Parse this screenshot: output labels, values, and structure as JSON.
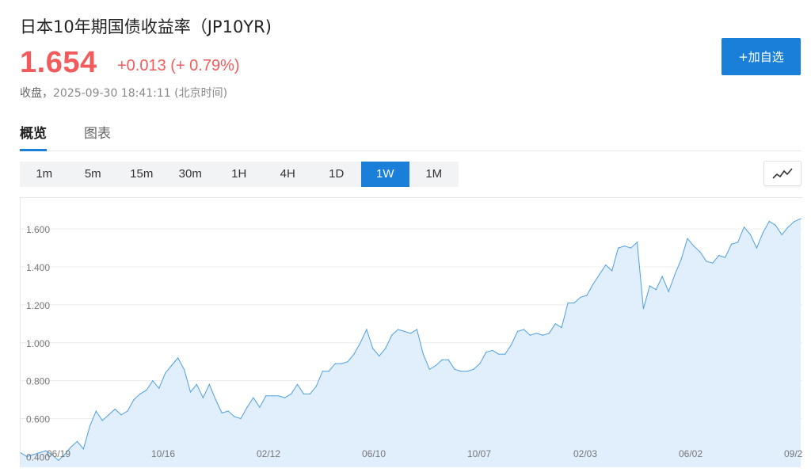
{
  "header": {
    "title": "日本10年期国债收益率（JP10YR)",
    "price": "1.654",
    "change": "+0.013 (+ 0.79%)",
    "status_label": "收盘，",
    "timestamp": "2025-09-30 18:41:11 (北京时间)",
    "add_button": "+加自选"
  },
  "tabs": [
    {
      "label": "概览",
      "active": true
    },
    {
      "label": "图表",
      "active": false
    }
  ],
  "intervals": [
    {
      "label": "1m"
    },
    {
      "label": "5m"
    },
    {
      "label": "15m"
    },
    {
      "label": "30m"
    },
    {
      "label": "1H"
    },
    {
      "label": "4H"
    },
    {
      "label": "1D"
    },
    {
      "label": "1W",
      "active": true
    },
    {
      "label": "1M"
    }
  ],
  "chart_type_icon": "line-chart-icon",
  "colors": {
    "accent": "#1a7fd9",
    "up": "#f25b5b",
    "line": "#4ea0e0",
    "area": "#e1eefb"
  },
  "chart_data": {
    "type": "area",
    "title": "",
    "xlabel": "",
    "ylabel": "",
    "ylim": [
      0.36,
      1.73
    ],
    "yticks": [
      0.4,
      0.6,
      0.8,
      1.0,
      1.2,
      1.4,
      1.6
    ],
    "ytick_labels": [
      "0.400",
      "0.600",
      "0.800",
      "1.000",
      "1.200",
      "1.400",
      "1.600"
    ],
    "xtick_labels": [
      "06/19",
      "10/16",
      "02/12",
      "06/10",
      "10/07",
      "02/03",
      "06/02",
      "09/2"
    ],
    "grid": true,
    "series": [
      {
        "values": [
          0.42,
          0.4,
          0.41,
          0.42,
          0.43,
          0.41,
          0.38,
          0.41,
          0.45,
          0.48,
          0.44,
          0.56,
          0.64,
          0.59,
          0.62,
          0.65,
          0.62,
          0.64,
          0.7,
          0.73,
          0.75,
          0.8,
          0.76,
          0.84,
          0.88,
          0.92,
          0.86,
          0.74,
          0.78,
          0.71,
          0.78,
          0.7,
          0.63,
          0.64,
          0.61,
          0.6,
          0.66,
          0.71,
          0.66,
          0.72,
          0.72,
          0.72,
          0.71,
          0.73,
          0.78,
          0.73,
          0.73,
          0.77,
          0.85,
          0.85,
          0.89,
          0.89,
          0.9,
          0.94,
          1.0,
          1.07,
          0.97,
          0.93,
          0.97,
          1.04,
          1.07,
          1.06,
          1.05,
          1.07,
          0.94,
          0.86,
          0.88,
          0.91,
          0.91,
          0.86,
          0.85,
          0.85,
          0.86,
          0.89,
          0.95,
          0.96,
          0.94,
          0.94,
          0.99,
          1.06,
          1.07,
          1.04,
          1.05,
          1.04,
          1.05,
          1.1,
          1.08,
          1.21,
          1.21,
          1.24,
          1.25,
          1.31,
          1.36,
          1.41,
          1.38,
          1.5,
          1.51,
          1.5,
          1.53,
          1.18,
          1.3,
          1.28,
          1.35,
          1.27,
          1.36,
          1.44,
          1.55,
          1.51,
          1.48,
          1.43,
          1.42,
          1.46,
          1.45,
          1.52,
          1.53,
          1.61,
          1.57,
          1.5,
          1.58,
          1.64,
          1.62,
          1.57,
          1.61,
          1.64,
          1.654
        ]
      }
    ]
  }
}
